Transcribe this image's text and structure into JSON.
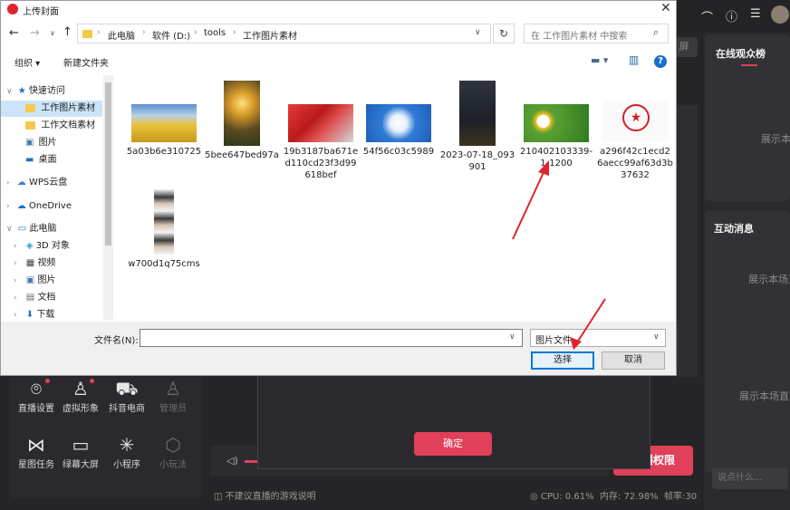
{
  "dialog": {
    "title": "上传封面",
    "address": [
      "此电脑",
      "软件 (D:)",
      "tools",
      "工作图片素材"
    ],
    "search_placeholder": "在 工作图片素材 中搜索",
    "toolbar": {
      "organize": "组织 ▾",
      "new_folder": "新建文件夹"
    },
    "nav": [
      {
        "label": "快速访问",
        "level": 0,
        "icon": "star"
      },
      {
        "label": "工作图片素材",
        "level": 1,
        "icon": "folder",
        "selected": true
      },
      {
        "label": "工作文档素材",
        "level": 1,
        "icon": "folder"
      },
      {
        "label": "图片",
        "level": 1,
        "icon": "pictures"
      },
      {
        "label": "桌面",
        "level": 1,
        "icon": "desktop"
      },
      {
        "label": "WPS云盘",
        "level": 0,
        "icon": "cloud"
      },
      {
        "label": "OneDrive",
        "level": 0,
        "icon": "cloud"
      },
      {
        "label": "此电脑",
        "level": 0,
        "icon": "pc"
      },
      {
        "label": "3D 对象",
        "level": 1,
        "icon": "3d"
      },
      {
        "label": "视频",
        "level": 1,
        "icon": "video"
      },
      {
        "label": "图片",
        "level": 1,
        "icon": "pictures"
      },
      {
        "label": "文档",
        "level": 1,
        "icon": "docs"
      },
      {
        "label": "下载",
        "level": 1,
        "icon": "download"
      }
    ],
    "files": [
      {
        "name": "5a03b6e310725"
      },
      {
        "name": "5bee647bed97a"
      },
      {
        "name": "19b3187ba671ed110cd23f3d99618bef"
      },
      {
        "name": "54f56c03c5989"
      },
      {
        "name": "2023-07-18_093901"
      },
      {
        "name": "210402103339-1-1200"
      },
      {
        "name": "a296f42c1ecd26aecc99af63d3b37632"
      },
      {
        "name": "w700d1q75cms"
      }
    ],
    "filename_label": "文件名(N):",
    "filename_value": "",
    "filetype": "图片文件",
    "select_btn": "选择",
    "cancel_btn": "取消"
  },
  "app": {
    "right_panel": {
      "online_title": "在线观众榜",
      "online_empty": "展示本",
      "msg_title": "互动消息",
      "msg_empty1": "展示本场直",
      "msg_empty2": "展示本场直",
      "chat_placeholder": "说点什么..."
    },
    "tools": [
      {
        "label": "直播设置",
        "icon": "⌾",
        "dot": true,
        "dim": false
      },
      {
        "label": "虚拟形象",
        "icon": "♙",
        "dot": true,
        "dim": false
      },
      {
        "label": "抖音电商",
        "icon": "🛒",
        "dot": false,
        "dim": false
      },
      {
        "label": "管理员",
        "icon": "♙",
        "dot": false,
        "dim": true
      },
      {
        "label": "星图任务",
        "icon": "⋈",
        "dot": false,
        "dim": false
      },
      {
        "label": "绿幕大屏",
        "icon": "▭",
        "dot": false,
        "dim": false
      },
      {
        "label": "小程序",
        "icon": "✳",
        "dot": false,
        "dim": false
      },
      {
        "label": "小玩法",
        "icon": "⬡",
        "dot": false,
        "dim": true
      }
    ],
    "confirm_btn": "确定",
    "permission_btn": "开播权限",
    "footer_left": "不建议直播的游戏说明",
    "stats": {
      "cpu": "CPU: 0.61%",
      "mem": "内存: 72.98%",
      "fps": "帧率:30"
    },
    "side_btn": "屏"
  },
  "colors": {
    "accent": "#e0405a",
    "select_border": "#0078d7",
    "annotation_arrow": "#e0242c"
  }
}
